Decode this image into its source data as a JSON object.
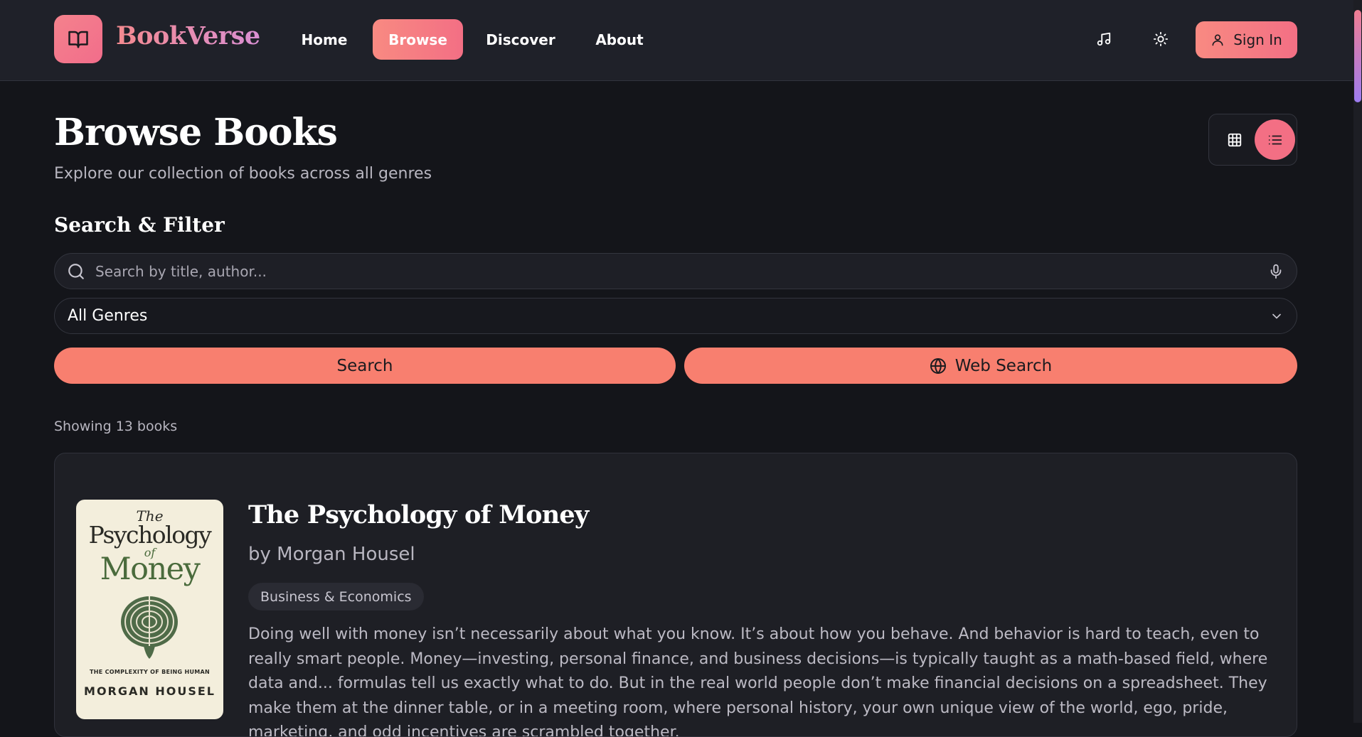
{
  "header": {
    "brand": "BookVerse",
    "nav": [
      {
        "label": "Home",
        "active": false
      },
      {
        "label": "Browse",
        "active": true
      },
      {
        "label": "Discover",
        "active": false
      },
      {
        "label": "About",
        "active": false
      }
    ],
    "icons": [
      "music-note-icon",
      "sun-icon"
    ],
    "signin_label": "Sign In"
  },
  "page": {
    "title": "Browse Books",
    "subtitle": "Explore our collection of books across all genres",
    "view_modes": [
      "grid",
      "list"
    ],
    "active_view": "list"
  },
  "filter": {
    "section_title": "Search & Filter",
    "search_placeholder": "Search by title, author...",
    "search_value": "",
    "genre_selected": "All Genres",
    "search_button": "Search",
    "web_search_button": "Web Search"
  },
  "results": {
    "count_text": "Showing 13 books",
    "books": [
      {
        "title": "The Psychology of Money",
        "author": "by Morgan Housel",
        "genre": "Business & Economics",
        "description": "Doing well with money isn’t necessarily about what you know. It’s about how you behave. And behavior is hard to teach, even to really smart people. Money—investing, personal finance, and business decisions—is typically taught as a math-based field, where data and... formulas tell us exactly what to do. But in the real world people don’t make financial decisions on a spreadsheet. They make them at the dinner table, or in a meeting room, where personal history, your own unique view of the world, ego, pride, marketing, and odd incentives are scrambled together.",
        "cover": {
          "line_the": "The",
          "line_psychology": "Psychology",
          "line_of": "of",
          "line_money": "Money",
          "tagline": "THE COMPLEXITY OF BEING HUMAN",
          "author": "MORGAN HOUSEL"
        }
      }
    ]
  },
  "colors": {
    "accent": "#f87f6f",
    "accent_pink": "#f36f84",
    "background": "#14151a",
    "header_bg": "#1f2129"
  }
}
